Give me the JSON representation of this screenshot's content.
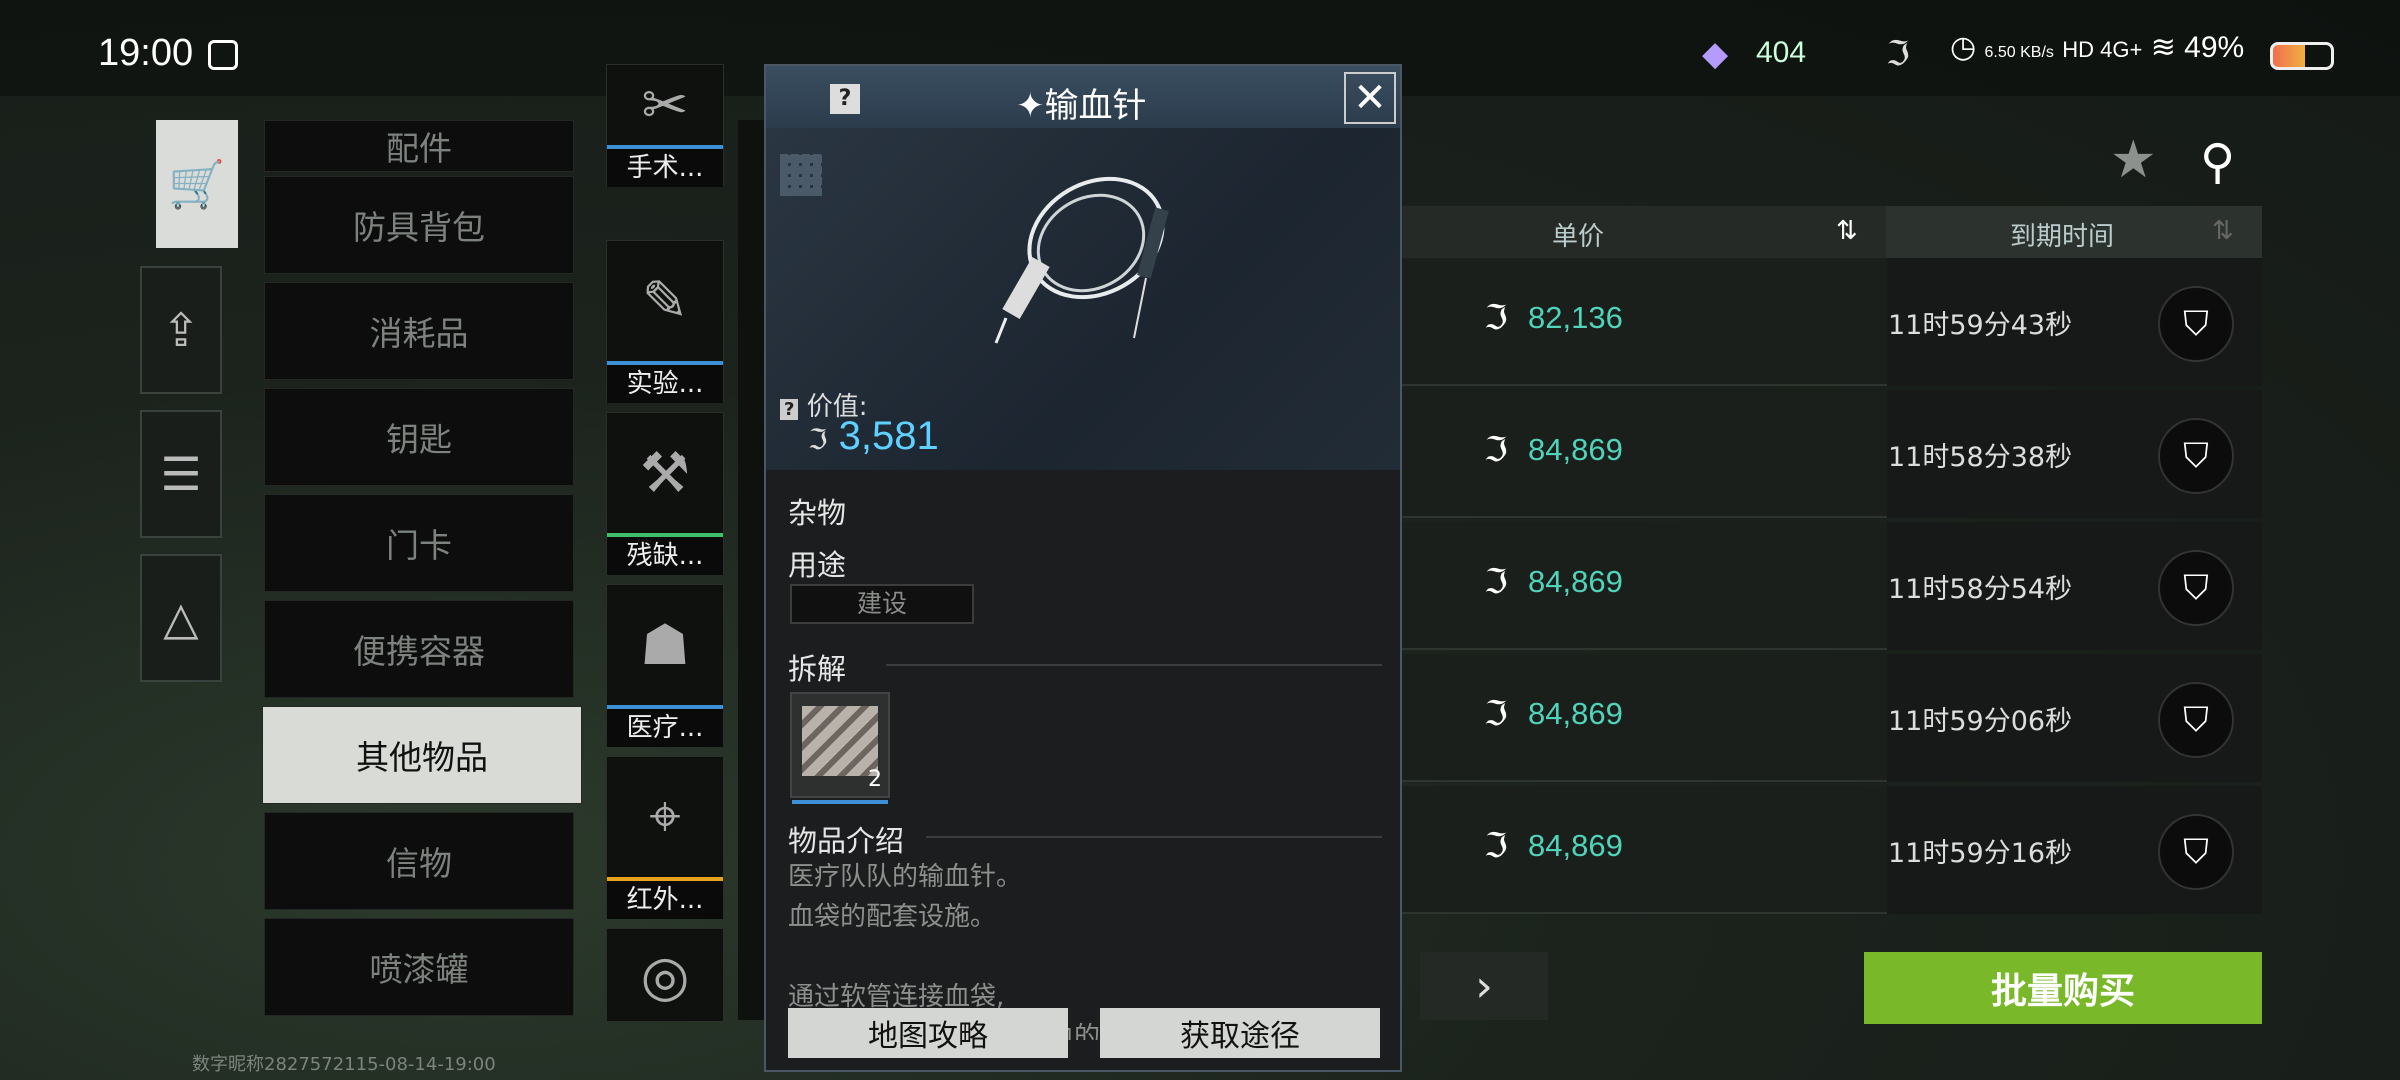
{
  "status_bar": {
    "time": "19:00",
    "gem_count": "404",
    "net_speed": "6.50 KB/s",
    "network": "HD 4G+",
    "battery": "49%"
  },
  "categories": [
    {
      "label": "配件"
    },
    {
      "label": "防具背包"
    },
    {
      "label": "消耗品"
    },
    {
      "label": "钥匙"
    },
    {
      "label": "门卡"
    },
    {
      "label": "便携容器"
    },
    {
      "label": "其他物品",
      "active": true
    },
    {
      "label": "信物"
    },
    {
      "label": "喷漆罐"
    }
  ],
  "items": [
    {
      "label": "手术...",
      "color": "#3d8fd6"
    },
    {
      "label": "实验...",
      "color": "#3d8fd6"
    },
    {
      "label": "残缺...",
      "color": "#3fbf6a"
    },
    {
      "label": "医疗...",
      "color": "#3d8fd6"
    },
    {
      "label": "红外...",
      "color": "#e6a31e"
    },
    {
      "label": "",
      "color": "#888888"
    }
  ],
  "table": {
    "col_price": "单价",
    "col_expire": "到期时间",
    "rows": [
      {
        "price": "82,136",
        "time": "11时59分43秒"
      },
      {
        "price": "84,869",
        "time": "11时58分38秒"
      },
      {
        "price": "84,869",
        "time": "11时58分54秒"
      },
      {
        "price": "84,869",
        "time": "11时59分06秒"
      },
      {
        "price": "84,869",
        "time": "11时59分16秒"
      }
    ]
  },
  "bulk_buy": "批量购买",
  "popup": {
    "title": "✦输血针",
    "value_label": "价值:",
    "value": "3,581",
    "type": "杂物",
    "usage_title": "用途",
    "usage_tag": "建设",
    "dismantle_title": "拆解",
    "dismantle_count": "2",
    "intro_title": "物品介绍",
    "desc1": "医疗队队的输血针。",
    "desc2": "血袋的配套设施。",
    "desc3": "通过软管连接血袋,",
    "desc4": "刺进人体血管，完成输血的功能",
    "btn_map": "地图攻略",
    "btn_source": "获取途径"
  },
  "watermark": "数字昵称2827572115-08-14-19:00"
}
